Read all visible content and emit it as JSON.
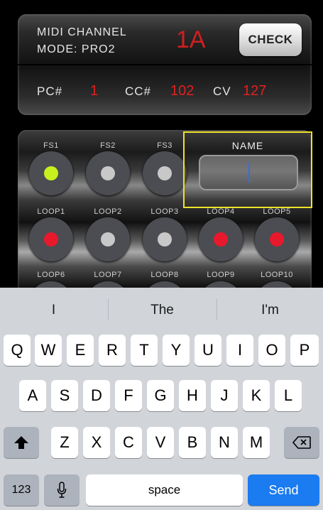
{
  "header": {
    "midi_channel_label": "MIDI CHANNEL",
    "mode_label": "MODE: PRO2",
    "channel_value": "1A",
    "check_button": "CHECK",
    "pc_label": "PC#",
    "pc_value": "1",
    "cc_label": "CC#",
    "cc_value": "102",
    "cv_label": "CV",
    "cv_value": "127"
  },
  "footswitches": [
    {
      "label": "FS1",
      "state": "green"
    },
    {
      "label": "FS2",
      "state": "off"
    },
    {
      "label": "FS3",
      "state": "off"
    }
  ],
  "name_field": {
    "label": "NAME",
    "value": ""
  },
  "loops_row1": [
    {
      "label": "LOOP1",
      "state": "red"
    },
    {
      "label": "LOOP2",
      "state": "off"
    },
    {
      "label": "LOOP3",
      "state": "off"
    },
    {
      "label": "LOOP4",
      "state": "red"
    },
    {
      "label": "LOOP5",
      "state": "red"
    }
  ],
  "loops_row2": [
    {
      "label": "LOOP6"
    },
    {
      "label": "LOOP7"
    },
    {
      "label": "LOOP8"
    },
    {
      "label": "LOOP9"
    },
    {
      "label": "LOOP10"
    }
  ],
  "keyboard": {
    "suggestions": [
      "I",
      "The",
      "I'm"
    ],
    "row1": [
      "Q",
      "W",
      "E",
      "R",
      "T",
      "Y",
      "U",
      "I",
      "O",
      "P"
    ],
    "row2": [
      "A",
      "S",
      "D",
      "F",
      "G",
      "H",
      "J",
      "K",
      "L"
    ],
    "row3": [
      "Z",
      "X",
      "C",
      "V",
      "B",
      "N",
      "M"
    ],
    "numbers_key": "123",
    "space_key": "space",
    "send_key": "Send"
  },
  "colors": {
    "accent_red": "#e02020",
    "led_green": "#c8f01e",
    "led_red": "#e8192c",
    "highlight_yellow": "#f0e22a",
    "send_blue": "#1b7bf0"
  }
}
